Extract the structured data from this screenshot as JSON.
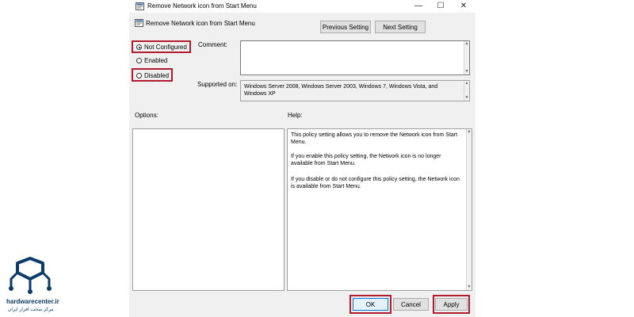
{
  "window": {
    "title": "Remove Network icon from Start Menu",
    "controls": {
      "minimize": "—",
      "maximize": "☐",
      "close": "✕"
    }
  },
  "header": {
    "policy_name": "Remove Network icon from Start Menu",
    "previous_setting": "Previous Setting",
    "next_setting": "Next Setting"
  },
  "options": {
    "not_configured": "Not Configured",
    "enabled": "Enabled",
    "disabled": "Disabled",
    "selected": "not_configured"
  },
  "labels": {
    "comment": "Comment:",
    "supported_on": "Supported on:",
    "options": "Options:",
    "help": "Help:"
  },
  "comment_value": "",
  "supported_on_value": "Windows Server 2008, Windows Server 2003, Windows 7, Windows Vista, and Windows XP",
  "help_paragraphs": [
    "This policy setting allows you to remove the Network icon from Start Menu.",
    "If you enable this policy setting, the Network icon is no longer available from Start Menu.",
    "If you disable or do not configure this policy setting, the Network icon is available from Start Menu."
  ],
  "footer": {
    "ok": "OK",
    "cancel": "Cancel",
    "apply": "Apply"
  },
  "watermark": {
    "name": "hardwarecenter.ir",
    "tagline": "مرکز سخت افزار ایران"
  },
  "colors": {
    "highlight": "#b01c2e",
    "window_bg": "#f0f0f0",
    "focus": "#0078d7"
  }
}
